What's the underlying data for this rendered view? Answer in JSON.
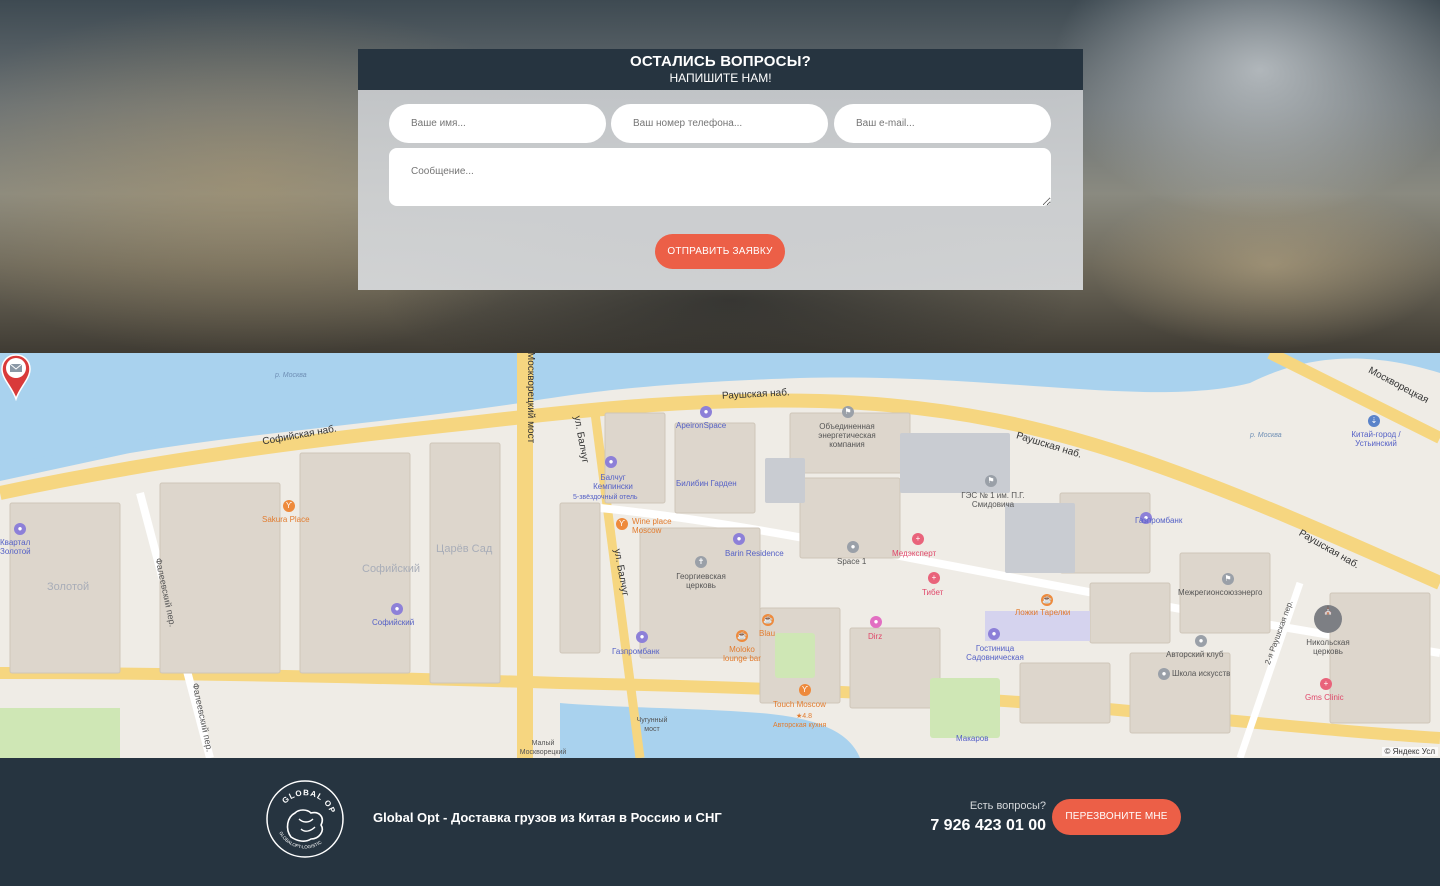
{
  "form": {
    "title": "ОСТАЛИСЬ ВОПРОСЫ?",
    "subtitle": "НАПИШИТЕ НАМ!",
    "name_placeholder": "Ваше имя...",
    "phone_placeholder": "Ваш номер телефона...",
    "email_placeholder": "Ваш e-mail...",
    "message_placeholder": "Сообщение...",
    "submit_label": "ОТПРАВИТЬ ЗАЯВКУ"
  },
  "map": {
    "streets": [
      "Софийская наб.",
      "Раушская наб.",
      "ул. Балчуг",
      "Москворецкий мост",
      "Фалеевский пер.",
      "Раушская наб.",
      "Москворецкая",
      "2-я Раушская пер."
    ],
    "river_label": "р. Москва",
    "places": {
      "apeiron": "ApeironSpace",
      "baltschug": "Балчуг Кемпински",
      "baltschug_sub": "5-звёздочный отель",
      "bilibin": "Билибин Гарден",
      "oek": "Объединенная энергетическая компания",
      "ges": "ГЭС № 1 им. П.Г. Смидовича",
      "gazprombank1": "Газпромбанк",
      "gazprombank2": "Газпромбанк",
      "medexpert": "Медэксперт",
      "tibet": "Тибет",
      "space1": "Space 1",
      "wine": "Wine place Moscow",
      "barin": "Barin Residence",
      "church": "Георгиевская церковь",
      "blau": "Blau",
      "moloko": "Moloko lounge bar",
      "touch": "Touch Moscow",
      "touch_sub": "Авторская кухня",
      "touch_rating": "★4.8",
      "dirz": "Dirz",
      "lozhki": "Ложки Тарелки",
      "gostinitsa": "Гостиница Садовническая",
      "mezhreg": "Межрегионсоюзэнерго",
      "nikolskaya": "Никольская церковь",
      "avtorsky": "Авторский клуб",
      "shkola": "Школа искусств",
      "gms": "Gms Clinic",
      "makarov": "Макаров",
      "sakura": "Sakura Place",
      "sofiysky_office": "Софийский",
      "kitay_gorod": "Китай-город / Устьинский",
      "zolotoy_kvartal": "Квартал Золотой",
      "chugunny": "Чугунный мост",
      "maly": "Малый Москворецкий"
    },
    "districts": [
      "Царёв Сад",
      "Софийский",
      "Золотой"
    ],
    "copyright": "© Яндекс  Усл"
  },
  "footer": {
    "brand": "Global Opt - Доставка грузов из Китая в Россию и СНГ",
    "logo_text_top": "GLOBAL OPT",
    "logo_text_bottom": "GLOBALOPT-LOGISTIC",
    "ask": "Есть вопросы?",
    "phone": "7 926 423 01 00",
    "callback_label": "ПЕРЕЗВОНИТЕ МНЕ"
  },
  "colors": {
    "dark": "#263440",
    "accent": "#ec5f47",
    "water": "#a9d2ee",
    "road": "#f6d680"
  }
}
